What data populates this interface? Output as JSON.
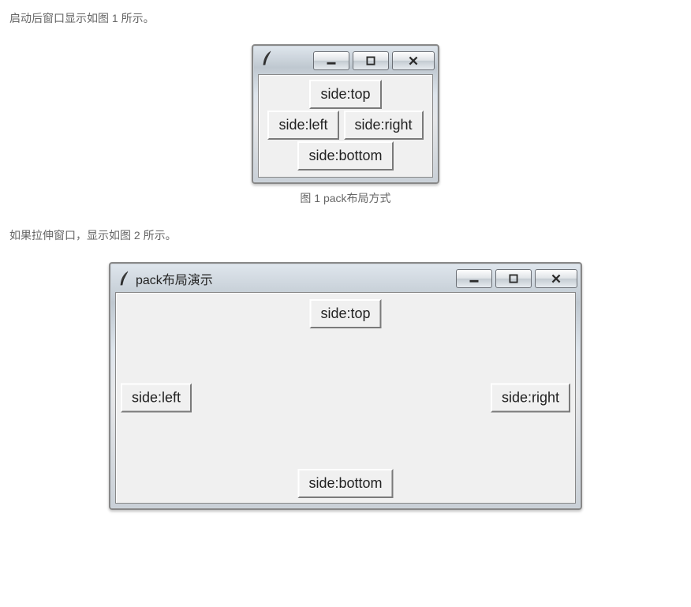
{
  "para1": "启动后窗口显示如图 1 所示。",
  "para2": "如果拉伸窗口，显示如图 2 所示。",
  "caption1": "图 1 pack布局方式",
  "fig1": {
    "title": "",
    "labels": {
      "top": "side:top",
      "left": "side:left",
      "right": "side:right",
      "bottom": "side:bottom"
    }
  },
  "fig2": {
    "title": "pack布局演示",
    "labels": {
      "top": "side:top",
      "left": "side:left",
      "right": "side:right",
      "bottom": "side:bottom"
    }
  }
}
